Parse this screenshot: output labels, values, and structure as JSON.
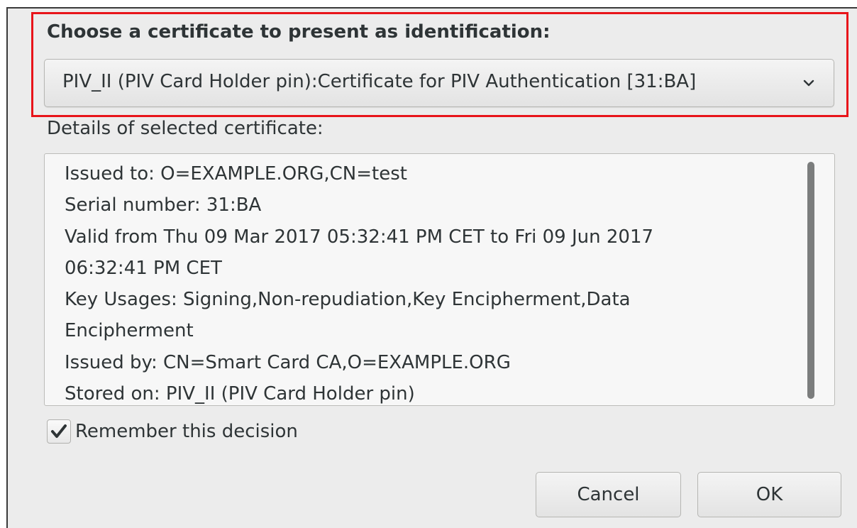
{
  "dialog": {
    "choose_label": "Choose a certificate to present as identification:",
    "certificate_select": {
      "selected": "PIV_II (PIV Card Holder pin):Certificate for PIV Authentication [31:BA]"
    },
    "details_label": "Details of selected certificate:",
    "details_lines": [
      "Issued to: O=EXAMPLE.ORG,CN=test",
      "Serial number: 31:BA",
      "Valid from Thu 09 Mar 2017 05:32:41 PM CET to Fri 09 Jun 2017",
      "06:32:41 PM CET",
      "Key Usages: Signing,Non-repudiation,Key Encipherment,Data",
      "Encipherment",
      "Issued by: CN=Smart Card CA,O=EXAMPLE.ORG",
      "Stored on: PIV_II (PIV Card Holder pin)"
    ],
    "remember_checkbox": {
      "label": "Remember this decision",
      "checked": true
    },
    "buttons": {
      "cancel": "Cancel",
      "ok": "OK"
    }
  },
  "colors": {
    "highlight": "#e8141a",
    "dialog_bg": "#ececec",
    "text": "#2e3436"
  }
}
